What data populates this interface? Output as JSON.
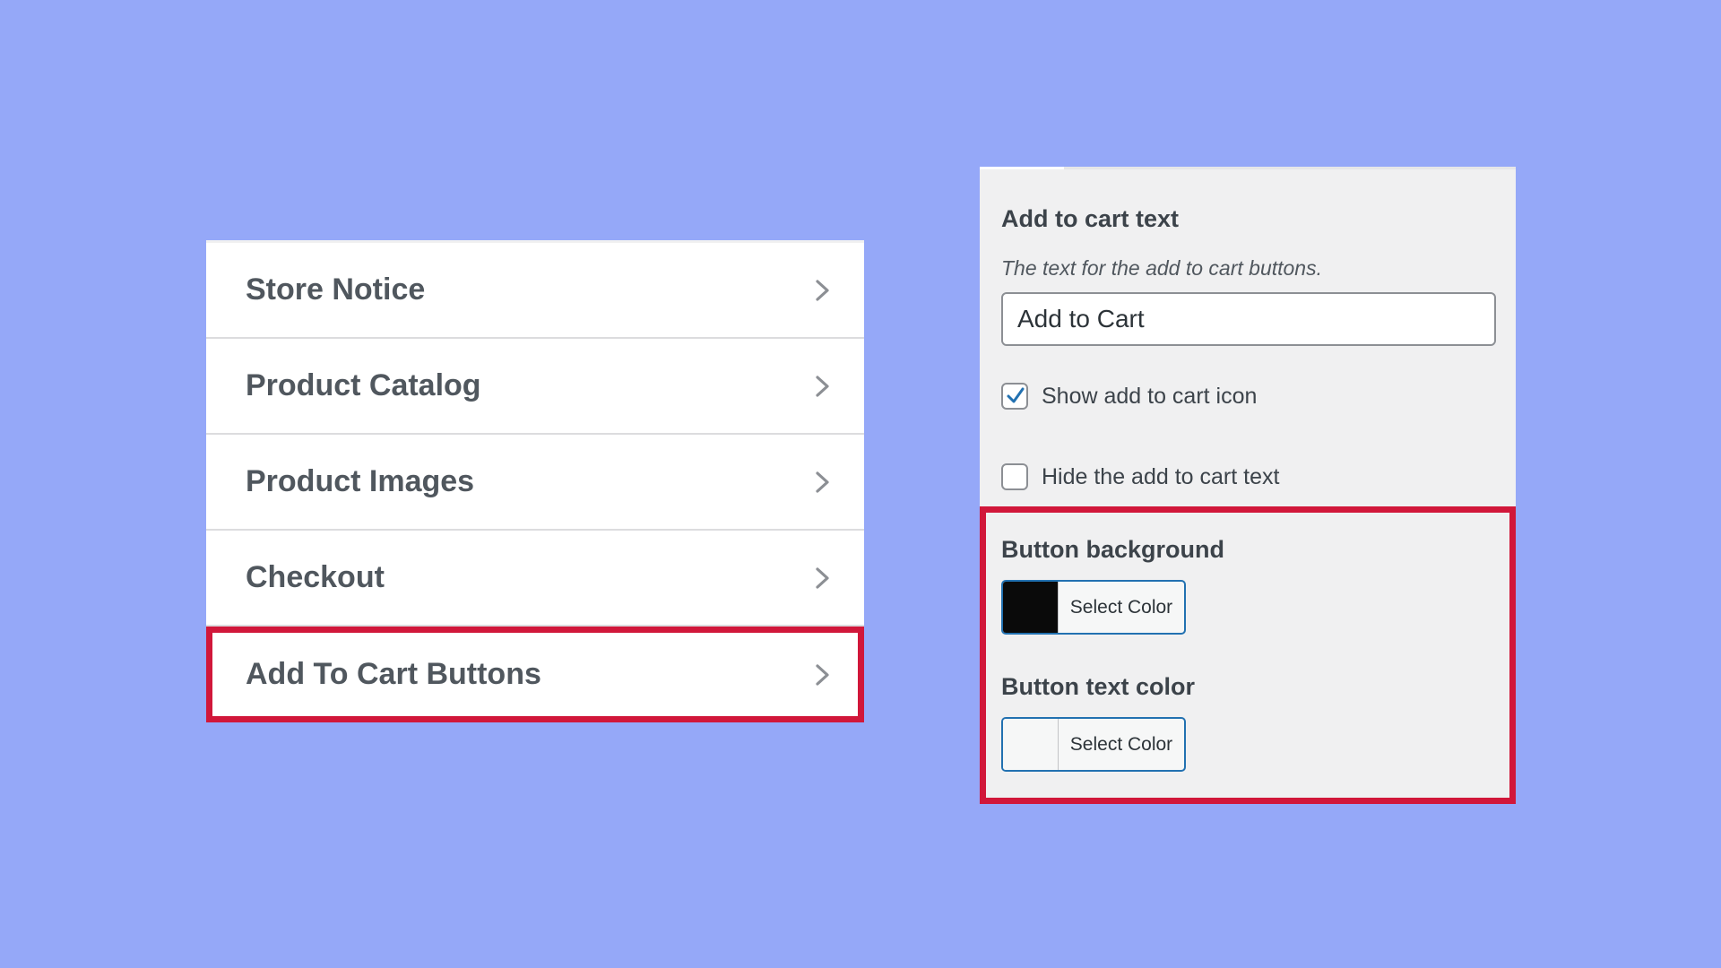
{
  "menu": {
    "items": [
      {
        "label": "Store Notice"
      },
      {
        "label": "Product Catalog"
      },
      {
        "label": "Product Images"
      },
      {
        "label": "Checkout"
      },
      {
        "label": "Add To Cart Buttons",
        "highlighted": true
      }
    ]
  },
  "settings": {
    "add_to_cart_text": {
      "title": "Add to cart text",
      "description": "The text for the add to cart buttons.",
      "value": "Add to Cart"
    },
    "show_icon": {
      "label": "Show add to cart icon",
      "checked": true
    },
    "hide_text": {
      "label": "Hide the add to cart text",
      "checked": false
    },
    "button_background": {
      "title": "Button background",
      "button_label": "Select Color",
      "color": "#0a0a0a"
    },
    "button_text_color": {
      "title": "Button text color",
      "button_label": "Select Color",
      "color": "#f6f7f7"
    }
  },
  "colors": {
    "background": "#95a8f8",
    "highlight": "#d1173a",
    "checkmark": "#2271b1"
  }
}
